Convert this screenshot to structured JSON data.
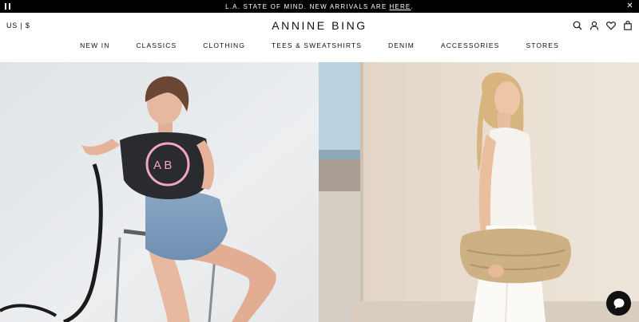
{
  "announcement": {
    "text": "L.A. STATE OF MIND. NEW ARRIVALS ARE",
    "link": "HERE",
    "suffix": "."
  },
  "header": {
    "locale": "US | $",
    "brand": "ANNINE BING",
    "nav": [
      "NEW IN",
      "CLASSICS",
      "CLOTHING",
      "TEES & SWEATSHIRTS",
      "DENIM",
      "ACCESSORIES",
      "STORES"
    ],
    "icons": [
      "search-icon",
      "account-icon",
      "wishlist-icon",
      "bag-icon"
    ]
  },
  "hero": {
    "left_image": "model-seated-denim-shorts",
    "right_image": "model-white-outfit-straw-bag"
  },
  "chat": {
    "icon": "chat-bubble-icon"
  },
  "colors": {
    "announcement_bg": "#000000",
    "text": "#111111",
    "left_bg": "#e8ebee",
    "right_wall": "#e9dfd3"
  }
}
